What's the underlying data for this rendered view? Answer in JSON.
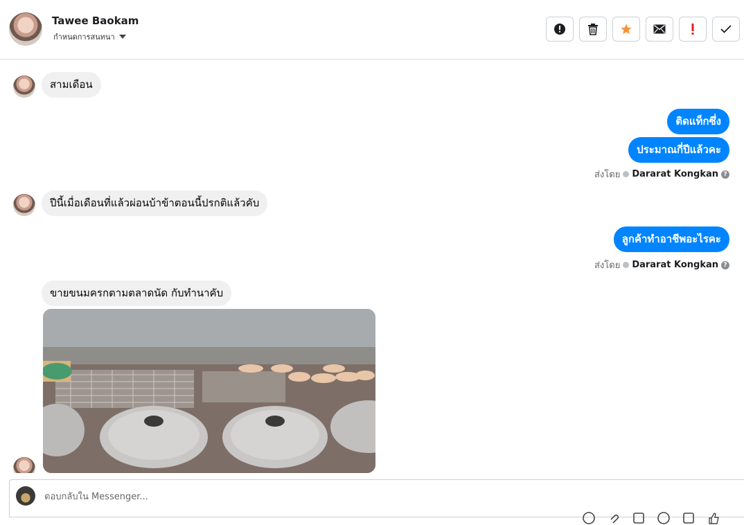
{
  "header": {
    "name": "Tawee Baokam",
    "assign_label": "กำหนดการสนทนา",
    "actions": [
      {
        "icon": "alert-circle-icon"
      },
      {
        "icon": "trash-icon"
      },
      {
        "icon": "star-icon",
        "color": "#f7923b"
      },
      {
        "icon": "mail-icon"
      },
      {
        "icon": "exclamation-icon",
        "color": "#e02020"
      },
      {
        "icon": "check-icon"
      }
    ]
  },
  "messages": [
    {
      "dir": "in",
      "text": "สามเดือน"
    },
    {
      "dir": "out",
      "text": "ติดแท็กซึ่ง"
    },
    {
      "dir": "out",
      "text": "ประมาณกี่ปีแล้วคะ"
    },
    {
      "dir": "in",
      "text": "ปีนี้เมื่อเดือนที่แล้วผ่อนบ้าข้าตอนนี้ปรกติแล้วคับ"
    },
    {
      "dir": "out",
      "text": "ลูกค้าทำอาชีพอะไรคะ"
    },
    {
      "dir": "in",
      "text": "ขายขนมครกตามตลาดนัด กับทำนาคับ"
    }
  ],
  "sent_by": {
    "prefix": "ส่งโดย",
    "agent": "Dararat Kongkan",
    "help": "?"
  },
  "photo": {
    "icon": "photo-image"
  },
  "reply": {
    "placeholder": "ตอบกลับใน Messenger..."
  },
  "colors": {
    "outgoing": "#0084ff",
    "incoming": "#f0f0f0"
  }
}
